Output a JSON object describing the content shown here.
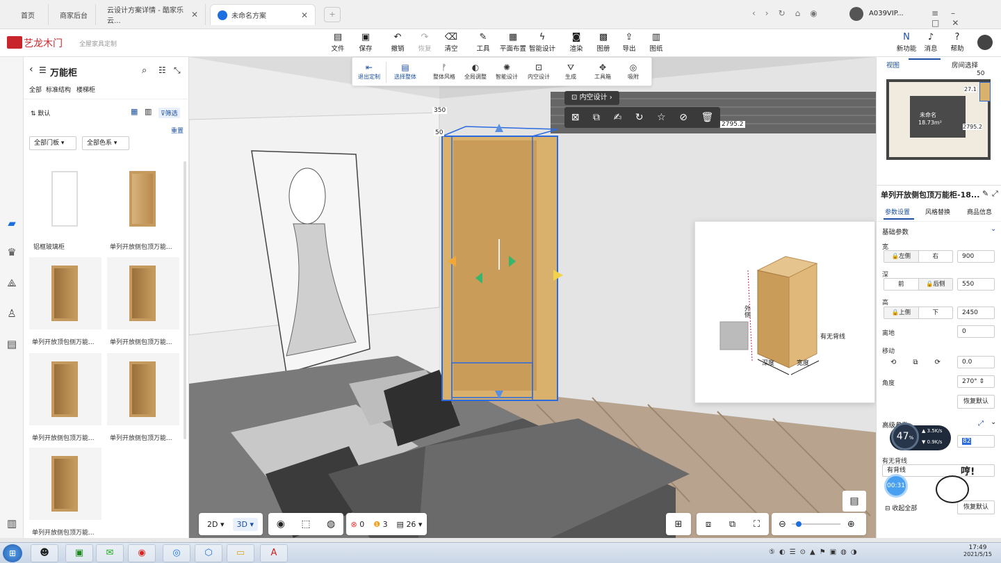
{
  "browser": {
    "tabs": [
      {
        "label": "首页"
      },
      {
        "label": "商家后台"
      },
      {
        "label": "云设计方案详情 - 酷家乐云..."
      },
      {
        "label": "未命名方案"
      }
    ],
    "user": "A039VIP..."
  },
  "app": {
    "logo": "艺龙木门",
    "subtitle": "全屋家具定制",
    "menu": [
      "文件",
      "保存",
      "撤销",
      "恢复",
      "清空",
      "工具",
      "平面布置",
      "智能设计",
      "渲染",
      "图册",
      "导出",
      "图纸"
    ],
    "right_menu": [
      "新功能",
      "消息",
      "帮助"
    ]
  },
  "subtoolbar": {
    "exit": "退出定制",
    "items": [
      "选择整体",
      "整体风格",
      "全局调整",
      "智能设计",
      "内空设计",
      "生成",
      "工具箱",
      "吸附"
    ]
  },
  "leftpanel": {
    "title": "万能柜",
    "filters": [
      "全部",
      "标准结构",
      "楼梯柜"
    ],
    "sort": "默认",
    "filter_btn": "筛选",
    "reset": "重置",
    "dropdowns": [
      "全部门板",
      "全部色系"
    ],
    "products": [
      "铝框玻璃柜",
      "单列开放侧包顶万能...",
      "单列开放顶包侧万能...",
      "单列开放侧包顶万能...",
      "单列开放侧包顶万能...",
      "单列开放侧包顶万能...",
      "单列开放侧包顶万能..."
    ]
  },
  "viewport": {
    "inner_design": "内空设计",
    "dim_top": "350",
    "dim_small": "50",
    "dim_width": "2795.2",
    "preview_label_left": "外侧",
    "preview_label_right": "有无背线",
    "preview_label_d1": "深度",
    "preview_label_d2": "宽度"
  },
  "minimap": {
    "tabs": [
      "视图",
      "房间选择"
    ],
    "size": "50",
    "room": "未命名",
    "area": "18.73m²",
    "dim1": "27.1",
    "dim2": "2795.2"
  },
  "rightpanel": {
    "title": "单列开放侧包顶万能柜-18...",
    "tabs": [
      "参数设置",
      "风格替换",
      "商品信息"
    ],
    "section": "基础参数",
    "width_label": "宽",
    "width_seg": [
      "左侧",
      "右"
    ],
    "width": "900",
    "depth_label": "深",
    "depth_seg": [
      "前",
      "后侧"
    ],
    "depth": "550",
    "height_label": "高",
    "height_seg": [
      "上侧",
      "下"
    ],
    "height": "2450",
    "offground_label": "离地",
    "offground": "0",
    "move_label": "移动",
    "move": "0.0",
    "angle_label": "角度",
    "angle": "270°",
    "reset": "恢复默认",
    "adv_section": "高级参数",
    "adv_value": "82",
    "backline_label": "有无背线",
    "backline_value": "有背线",
    "collapse": "收起全部",
    "reset2": "恢复默认"
  },
  "overlay": {
    "percent": "47",
    "up": "3.5K/s",
    "down": "0.9K/s",
    "timer": "00:31",
    "mascot_text": "哼!"
  },
  "bottombar": {
    "view2d": "2D",
    "view3d": "3D",
    "errors": "0",
    "warnings": "3",
    "count": "26"
  },
  "taskbar": {
    "time": "17:49",
    "date": "2021/5/15"
  }
}
